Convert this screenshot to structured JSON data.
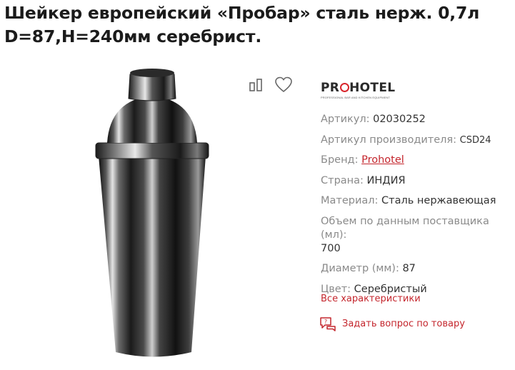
{
  "product": {
    "title_line1": "Шейкер европейский «Пробар» сталь нерж. 0,7л",
    "title_line2": "D=87,H=240мм серебрист."
  },
  "actions": {
    "compare_icon": "compare-icon",
    "favorite_icon": "heart-icon"
  },
  "brand_logo": {
    "text_before": "PR",
    "text_after": "HOTEL",
    "subtitle": "PROFESSIONAL BAR AND KITCHEN EQUIPMENT",
    "accent_color": "#d8262c"
  },
  "specs": [
    {
      "label": "Артикул:",
      "value": "02030252"
    },
    {
      "label": "Артикул производителя:",
      "value": "CSD24"
    },
    {
      "label": "Бренд:",
      "value": "Prohotel"
    },
    {
      "label": "Страна:",
      "value": "ИНДИЯ"
    },
    {
      "label": "Материал:",
      "value": "Сталь нержавеющая"
    },
    {
      "label": "Объем по данным поставщика (мл):",
      "value": "700"
    },
    {
      "label": "Диаметр (мм):",
      "value": "87"
    },
    {
      "label": "Цвет:",
      "value": "Серебристый"
    }
  ],
  "links": {
    "all_specs": "Все характеристики",
    "ask_question": "Задать вопрос по товару"
  },
  "colors": {
    "accent": "#c4262d",
    "label_gray": "#8a8a8a"
  }
}
